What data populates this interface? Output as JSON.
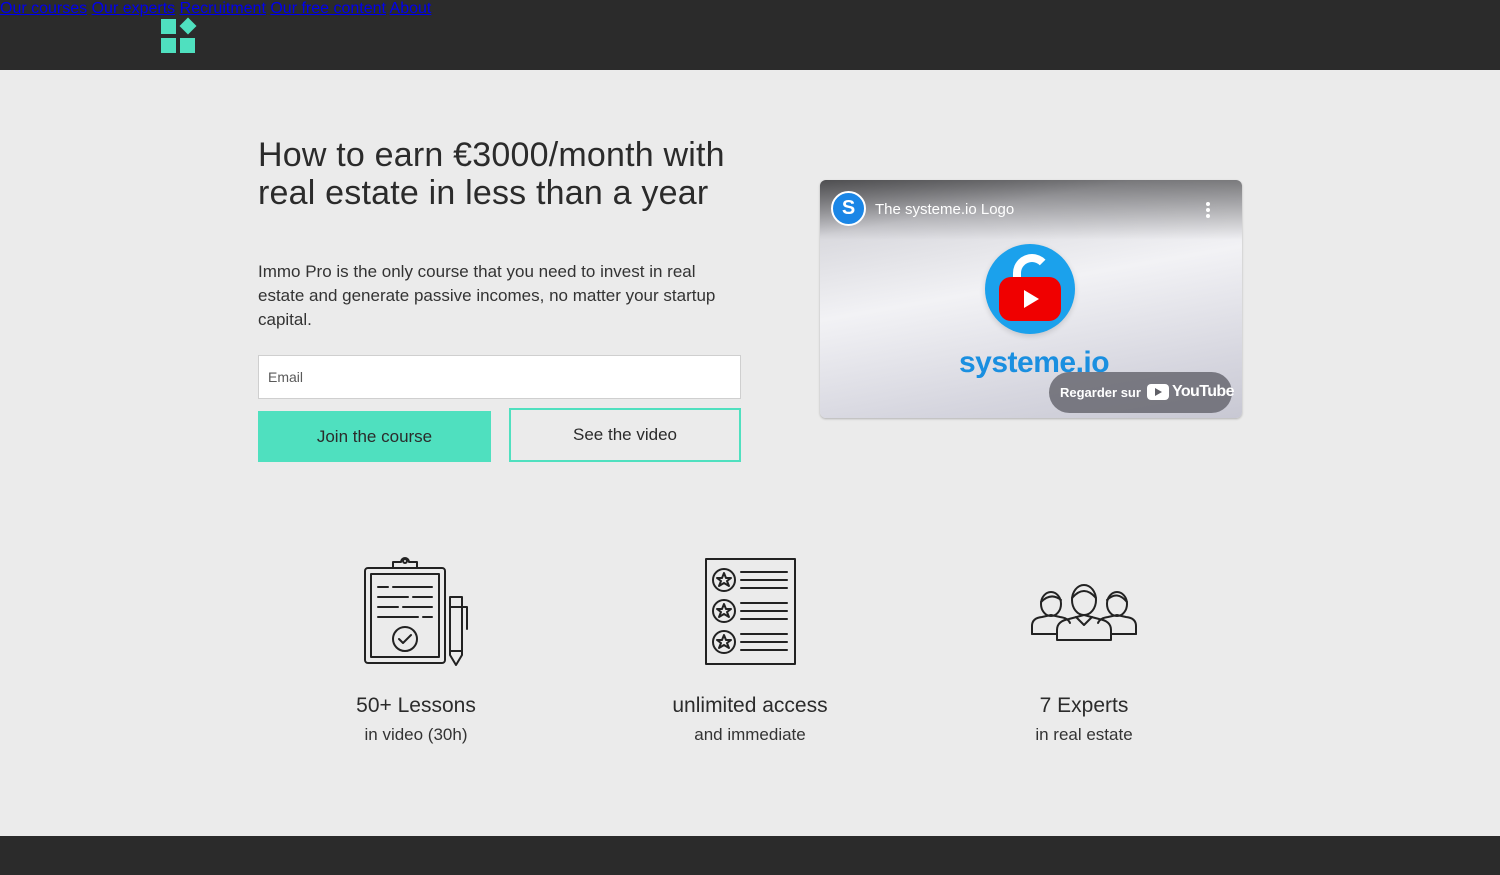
{
  "nav": {
    "items": [
      "Our courses",
      "Our experts",
      "Recruitment",
      "Our free content",
      "About"
    ]
  },
  "hero": {
    "title": "How to earn €3000/month with real estate in less than a year",
    "description": "Immo Pro is the only course that you need to invest in real estate and generate passive incomes, no matter your startup capital.",
    "email_placeholder": "Email",
    "join_label": "Join the course",
    "video_label": "See the video"
  },
  "video": {
    "channel_initial": "S",
    "title": "The systeme.io Logo",
    "brand": "systeme.io",
    "watch_on": "Regarder sur",
    "platform": "YouTube"
  },
  "features": [
    {
      "icon": "clipboard-checklist-icon",
      "title": "50+ Lessons",
      "subtitle": "in video (30h)"
    },
    {
      "icon": "star-list-document-icon",
      "title": "unlimited access",
      "subtitle": "and immediate"
    },
    {
      "icon": "team-people-icon",
      "title": "7 Experts",
      "subtitle": "in real estate"
    }
  ],
  "colors": {
    "accent": "#4fe0bf",
    "dark": "#2b2b2b",
    "background": "#ebebeb"
  }
}
